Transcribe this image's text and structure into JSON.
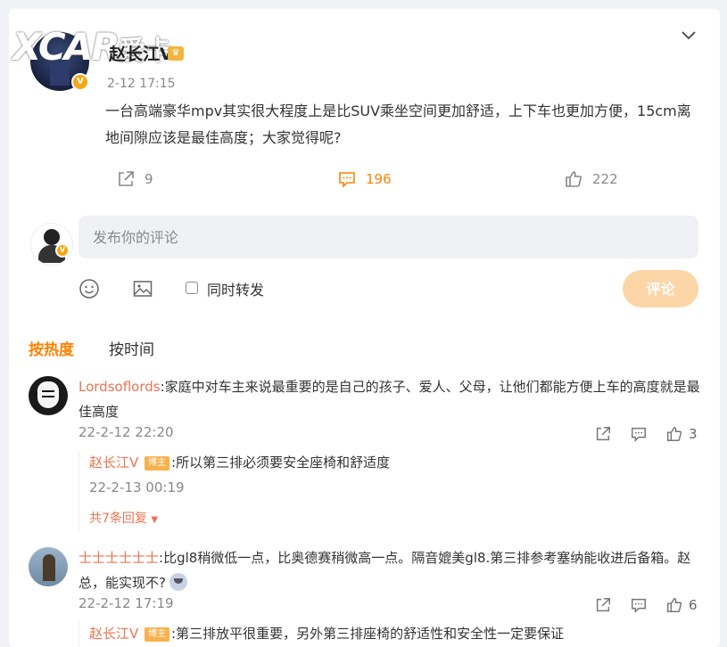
{
  "logo": {
    "text": "XCAR",
    "sub": "爱卡"
  },
  "post": {
    "author": "赵长江V",
    "time": "2-12 17:15",
    "content": "一台高端豪华mpv其实很大程度上是比SUV乘坐空间更加舒适，上下车也更加方便，15cm离地间隙应该是最佳高度；大家觉得呢?",
    "repost_count": "9",
    "comment_count": "196",
    "like_count": "222"
  },
  "composer": {
    "placeholder": "发布你的评论",
    "repost_label": "同时转发",
    "submit_label": "评论"
  },
  "sort": {
    "hot": "按热度",
    "time": "按时间"
  },
  "comments": [
    {
      "user": "Lordsoflords",
      "text": ":家庭中对车主来说最重要的是自己的孩子、爱人、父母，让他们都能方便上车的高度就是最佳高度",
      "time": "22-2-12 22:20",
      "likes": "3",
      "reply": {
        "user": "赵长江V",
        "badge": "博主",
        "text": ":所以第三排必须要安全座椅和舒适度",
        "time": "22-2-13 00:19"
      },
      "more": "共7条回复"
    },
    {
      "user": "士士士士士士",
      "text": ":比gl8稍微低一点，比奥德赛稍微高一点。隔音媲美gl8.第三排参考塞纳能收进后备箱。赵总，能实现不?",
      "time": "22-2-12 17:19",
      "likes": "6",
      "reply": {
        "user": "赵长江V",
        "badge": "博主",
        "text": ":第三排放平很重要，另外第三排座椅的舒适性和安全性一定要保证"
      }
    }
  ],
  "colors": {
    "accent": "#ff8200",
    "link": "#eb7350",
    "submit_disabled": "#fcd6a6"
  }
}
